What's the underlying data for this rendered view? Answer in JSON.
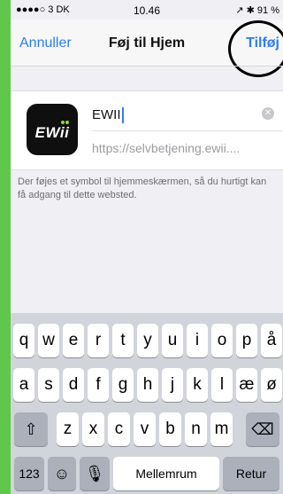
{
  "status_bar": {
    "carrier": "●●●●○ 3 DK",
    "time": "10.46",
    "right_status": "↗ ✱ 91 %"
  },
  "nav": {
    "cancel_label": "Annuller",
    "title": "Føj til Hjem",
    "add_label": "Tilføj"
  },
  "form": {
    "app_icon_text": "EWii",
    "name_value": "EWII",
    "url_value": "https://selvbetjening.ewii....",
    "clear_icon": "clear-icon"
  },
  "description": "Der føjes et symbol til hjemmeskærmen, så du hurtigt kan få adgang til dette websted.",
  "keyboard": {
    "row1": [
      "q",
      "w",
      "e",
      "r",
      "t",
      "y",
      "u",
      "i",
      "o",
      "p",
      "å"
    ],
    "row2": [
      "a",
      "s",
      "d",
      "f",
      "g",
      "h",
      "j",
      "k",
      "l",
      "æ",
      "ø"
    ],
    "row3": [
      "z",
      "x",
      "c",
      "v",
      "b",
      "n",
      "m"
    ],
    "shift": "⇧",
    "backspace": "⌫",
    "numbers": "123",
    "emoji": "☺",
    "mic": "🎙",
    "space": "Mellemrum",
    "return": "Retur"
  },
  "colors": {
    "accent": "#2f7cf6",
    "frame": "#5fc84a"
  }
}
